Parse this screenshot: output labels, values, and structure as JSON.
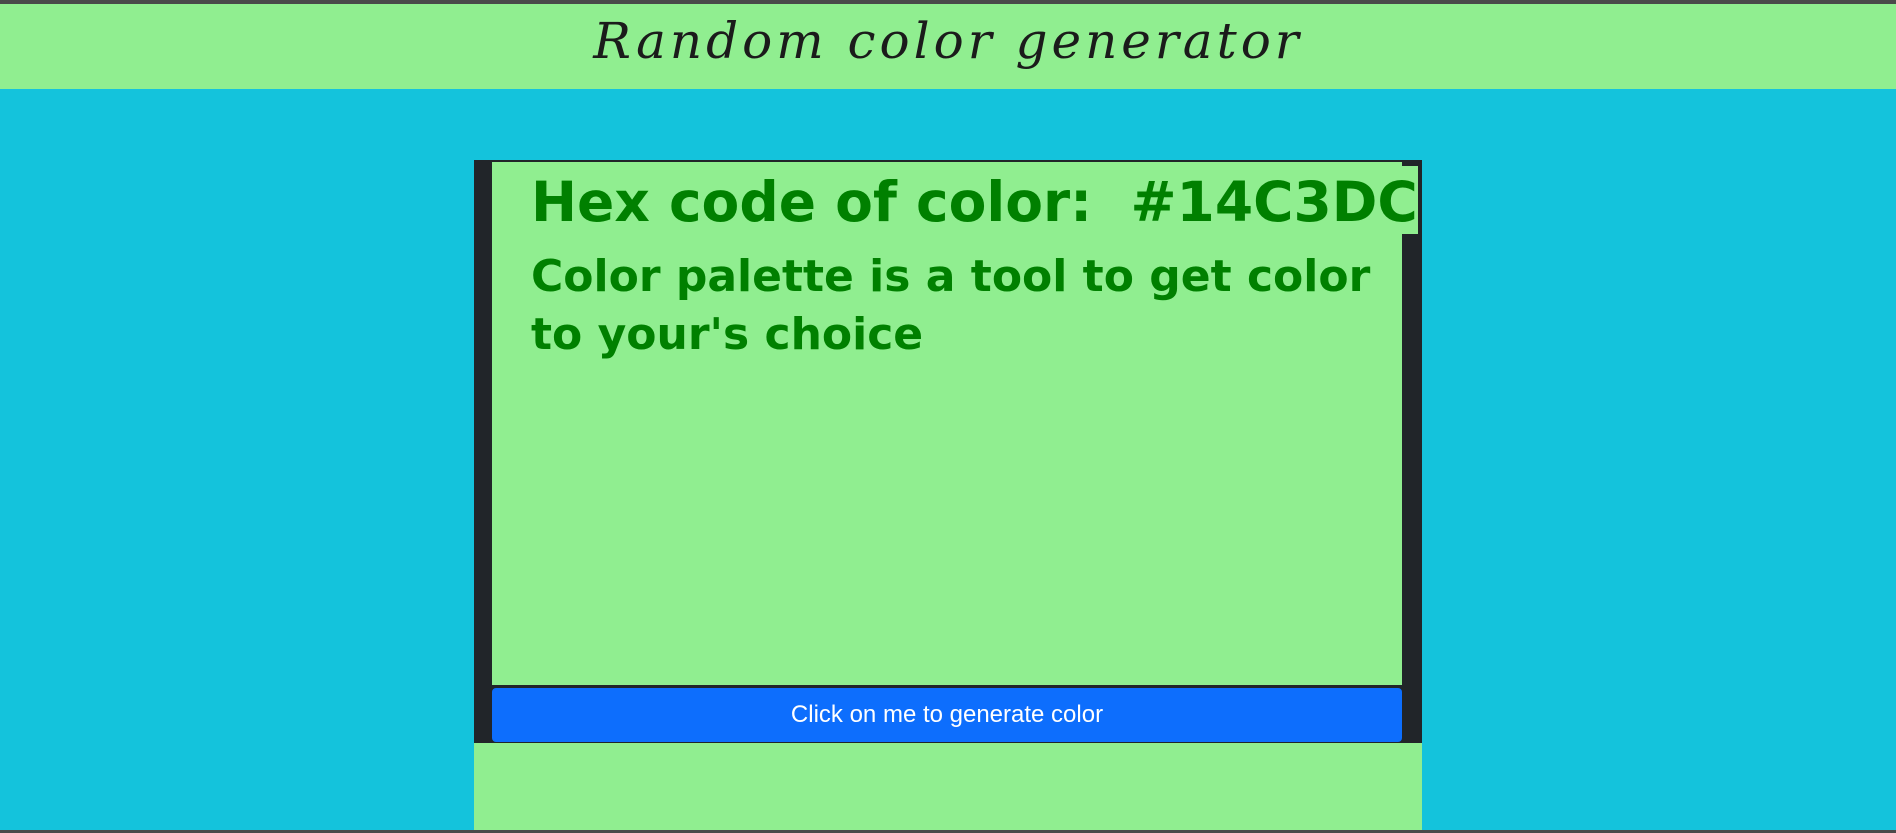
{
  "header": {
    "title": "Random color generator"
  },
  "panel": {
    "hex_label": "Hex code of color:",
    "hex_value": "#14C3DC",
    "description": "Color palette is a tool to get color to your's choice"
  },
  "button": {
    "label": "Click on me to generate color"
  },
  "colors": {
    "page_background": "#14C3DC",
    "panel_background": "#90EE90",
    "text": "#008000",
    "frame": "#212529",
    "button": "#0D6EFD"
  }
}
